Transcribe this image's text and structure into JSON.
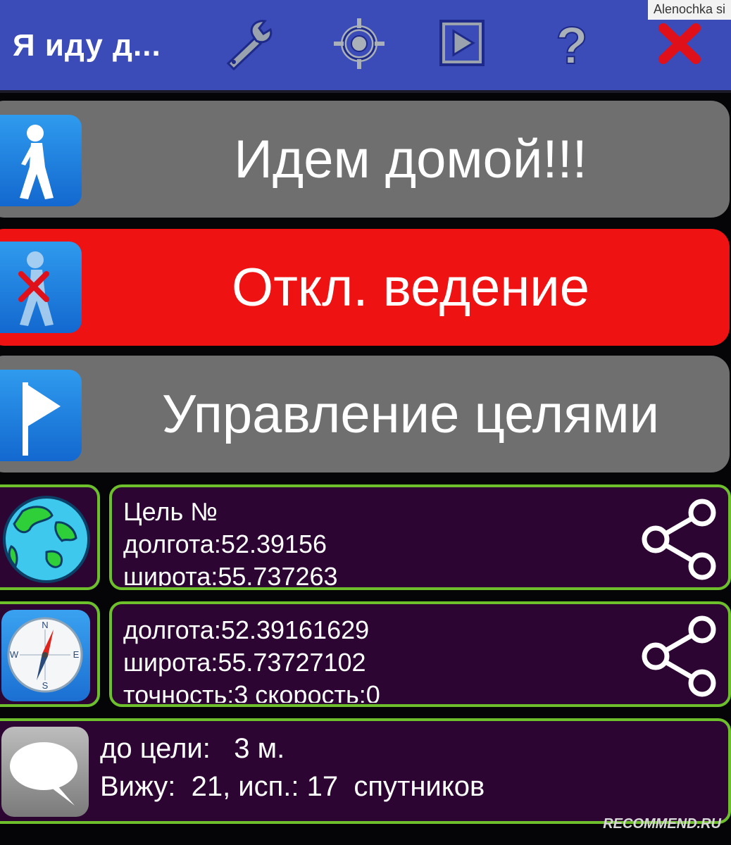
{
  "watermark_top": "Alenochka si",
  "watermark_bottom": "RECOMMEND.RU",
  "header": {
    "title": "Я иду д...",
    "icons": [
      "wrench-icon",
      "crosshair-icon",
      "play-icon",
      "help-icon",
      "close-icon"
    ]
  },
  "buttons": {
    "home": "Идем домой!!!",
    "guidance_off": "Откл. ведение",
    "targets": "Управление целями"
  },
  "target_panel": {
    "line1": "Цель №",
    "line2": "долгота:52.39156",
    "line3": "широта:55.737263"
  },
  "gps_panel": {
    "line1": "долгота:52.39161629",
    "line2": "широта:55.73727102",
    "line3": "точность:3 скорость:0"
  },
  "status_panel": {
    "line1": "до цели:   3 м.",
    "line2": "Вижу:  21, исп.: 17  спутников"
  },
  "colors": {
    "action_bar": "#3b4bb7",
    "button_gray": "#6f6f6f",
    "button_red": "#ee1212",
    "panel_bg": "#2c0533",
    "panel_border": "#6ebf2c"
  }
}
